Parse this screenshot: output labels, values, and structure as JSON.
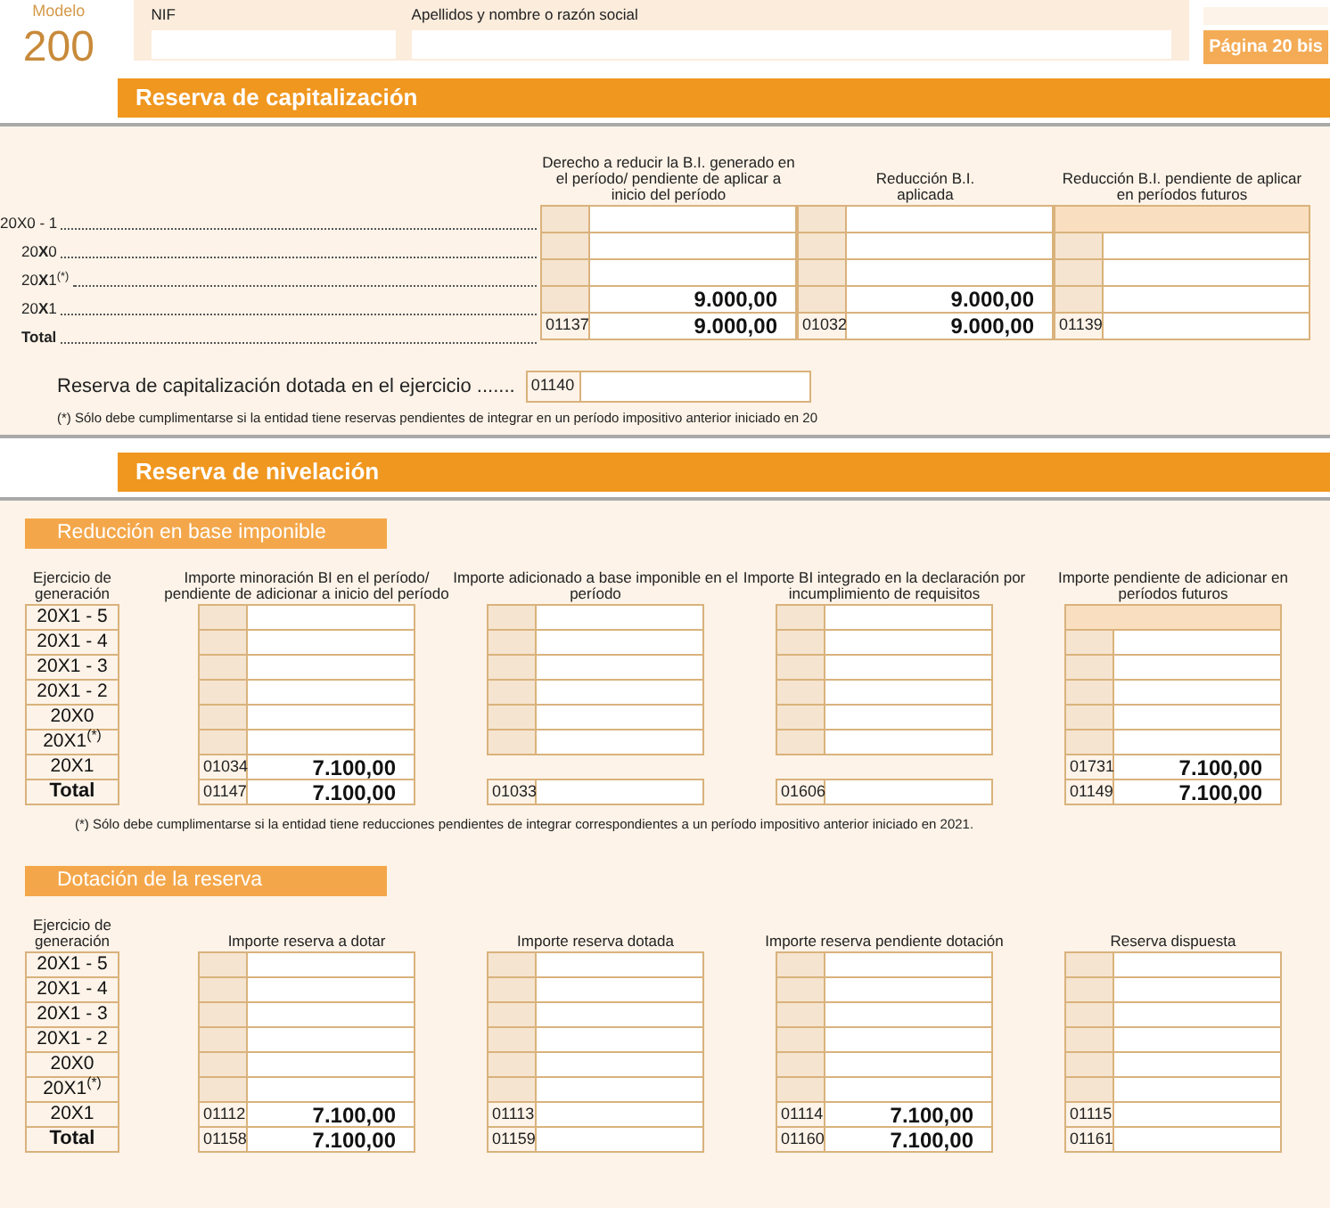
{
  "header": {
    "model_label": "Modelo",
    "model_number": "200",
    "nif_label": "NIF",
    "name_label": "Apellidos y nombre o razón social",
    "page_label": "Página 20 bis"
  },
  "capitalizacion": {
    "title": "Reserva de capitalización",
    "columns": [
      "Derecho a reducir la B.I. generado en el período/ pendiente de aplicar a inicio del período",
      "Reducción B.I. aplicada",
      "Reducción B.I. pendiente de aplicar en períodos futuros"
    ],
    "rows": [
      {
        "label": "20X0 - 1",
        "kind": "normal",
        "cells": [
          {
            "kind": "input"
          },
          {
            "kind": "input"
          },
          {
            "kind": "shaded"
          }
        ]
      },
      {
        "label": "20**X**0",
        "kind": "normal",
        "cells": [
          {
            "kind": "input"
          },
          {
            "kind": "input"
          },
          {
            "kind": "input"
          }
        ]
      },
      {
        "label": "20**X**1$^{(*)}$",
        "kind": "normal",
        "cells": [
          {
            "kind": "input"
          },
          {
            "kind": "input"
          },
          {
            "kind": "input"
          }
        ]
      },
      {
        "label": "20**X**1",
        "kind": "normal",
        "cells": [
          {
            "kind": "input",
            "value": "9.000,00"
          },
          {
            "kind": "input",
            "value": "9.000,00"
          },
          {
            "kind": "input"
          }
        ]
      },
      {
        "label": "Total",
        "kind": "total",
        "cells": [
          {
            "kind": "coded",
            "code": "01137",
            "value": "9.000,00"
          },
          {
            "kind": "coded",
            "code": "01032",
            "value": "9.000,00"
          },
          {
            "kind": "coded",
            "code": "01139"
          }
        ]
      }
    ],
    "reserve_line": {
      "label": "Reserva de capitalización dotada en el ejercicio .......",
      "code": "01140"
    },
    "footnote": "(*) Sólo debe cumplimentarse si la entidad tiene reservas pendientes de integrar en un período impositivo anterior iniciado en 20"
  },
  "nivelacion": {
    "title": "Reserva de nivelación",
    "tables": [
      {
        "title": "Reducción en base imponible",
        "label_heading": "Ejercicio de generación",
        "row_labels": [
          {
            "text": "20X1 - 5",
            "kind": "normal"
          },
          {
            "text": "20X1 - 4",
            "kind": "normal"
          },
          {
            "text": "20X1 - 3",
            "kind": "normal"
          },
          {
            "text": "20X1 - 2",
            "kind": "normal"
          },
          {
            "text": "20X0",
            "kind": "normal"
          },
          {
            "text": "20X1$^{(*)}$",
            "kind": "normal"
          },
          {
            "text": "20X1",
            "kind": "normal"
          },
          {
            "text": "Total",
            "kind": "total"
          }
        ],
        "columns": [
          {
            "heading": "Importe minoración BI en el período/ pendiente de adicionar a inicio del período",
            "cells": [
              {
                "kind": "input"
              },
              {
                "kind": "input"
              },
              {
                "kind": "input"
              },
              {
                "kind": "input"
              },
              {
                "kind": "input"
              },
              {
                "kind": "input"
              },
              {
                "kind": "coded",
                "code": "01034",
                "value": "7.100,00"
              },
              {
                "kind": "coded",
                "code": "01147",
                "value": "7.100,00"
              }
            ]
          },
          {
            "heading": "Importe adicionado a base imponible en el período",
            "cells": [
              {
                "kind": "input"
              },
              {
                "kind": "input"
              },
              {
                "kind": "input"
              },
              {
                "kind": "input"
              },
              {
                "kind": "input"
              },
              {
                "kind": "input"
              },
              {
                "kind": "none"
              },
              {
                "kind": "coded",
                "code": "01033"
              }
            ]
          },
          {
            "heading": "Importe BI integrado en la declaración por incumplimiento de requisitos",
            "cells": [
              {
                "kind": "input"
              },
              {
                "kind": "input"
              },
              {
                "kind": "input"
              },
              {
                "kind": "input"
              },
              {
                "kind": "input"
              },
              {
                "kind": "input"
              },
              {
                "kind": "none"
              },
              {
                "kind": "coded",
                "code": "01606"
              }
            ]
          },
          {
            "heading": "Importe pendiente de adicionar en períodos futuros",
            "cells": [
              {
                "kind": "shaded"
              },
              {
                "kind": "input"
              },
              {
                "kind": "input"
              },
              {
                "kind": "input"
              },
              {
                "kind": "input"
              },
              {
                "kind": "input"
              },
              {
                "kind": "coded",
                "code": "01731",
                "value": "7.100,00"
              },
              {
                "kind": "coded",
                "code": "01149",
                "value": "7.100,00"
              }
            ]
          }
        ],
        "footnote": "(*) Sólo debe cumplimentarse si la entidad tiene reducciones pendientes de integrar correspondientes a un período impositivo anterior iniciado en 2021."
      },
      {
        "title": "Dotación de la reserva",
        "label_heading": "Ejercicio de generación",
        "row_labels": [
          {
            "text": "20X1 - 5",
            "kind": "normal"
          },
          {
            "text": "20X1 - 4",
            "kind": "normal"
          },
          {
            "text": "20X1 - 3",
            "kind": "normal"
          },
          {
            "text": "20X1 - 2",
            "kind": "normal"
          },
          {
            "text": "20X0",
            "kind": "normal"
          },
          {
            "text": "20X1$^{(*)}$",
            "kind": "normal"
          },
          {
            "text": "20X1",
            "kind": "normal"
          },
          {
            "text": "Total",
            "kind": "total"
          }
        ],
        "columns": [
          {
            "heading": "Importe reserva a dotar",
            "cells": [
              {
                "kind": "input"
              },
              {
                "kind": "input"
              },
              {
                "kind": "input"
              },
              {
                "kind": "input"
              },
              {
                "kind": "input"
              },
              {
                "kind": "input"
              },
              {
                "kind": "coded",
                "code": "01112",
                "value": "7.100,00"
              },
              {
                "kind": "coded",
                "code": "01158",
                "value": "7.100,00"
              }
            ]
          },
          {
            "heading": "Importe reserva dotada",
            "cells": [
              {
                "kind": "input"
              },
              {
                "kind": "input"
              },
              {
                "kind": "input"
              },
              {
                "kind": "input"
              },
              {
                "kind": "input"
              },
              {
                "kind": "input"
              },
              {
                "kind": "coded",
                "code": "01113"
              },
              {
                "kind": "coded",
                "code": "01159"
              }
            ]
          },
          {
            "heading": "Importe reserva pendiente dotación",
            "cells": [
              {
                "kind": "input"
              },
              {
                "kind": "input"
              },
              {
                "kind": "input"
              },
              {
                "kind": "input"
              },
              {
                "kind": "input"
              },
              {
                "kind": "input"
              },
              {
                "kind": "coded",
                "code": "01114",
                "value": "7.100,00"
              },
              {
                "kind": "coded",
                "code": "01160",
                "value": "7.100,00"
              }
            ]
          },
          {
            "heading": "Reserva dispuesta",
            "cells": [
              {
                "kind": "input"
              },
              {
                "kind": "input"
              },
              {
                "kind": "input"
              },
              {
                "kind": "input"
              },
              {
                "kind": "input"
              },
              {
                "kind": "input"
              },
              {
                "kind": "coded",
                "code": "01115"
              },
              {
                "kind": "coded",
                "code": "01161"
              }
            ]
          }
        ]
      }
    ]
  }
}
